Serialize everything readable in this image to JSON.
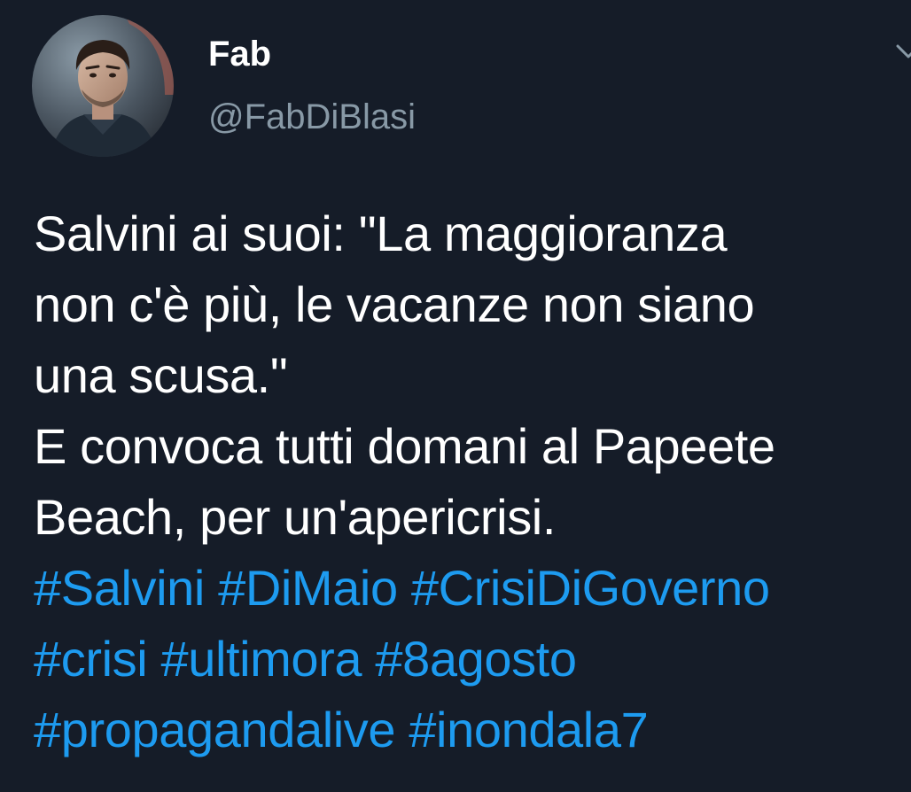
{
  "tweet": {
    "author": {
      "display_name": "Fab",
      "handle": "@FabDiBlasi",
      "avatar_icon": "profile-photo"
    },
    "menu_icon": "chevron-down-icon",
    "text_lines": [
      "Salvini ai suoi: \"La maggioranza",
      "non c'è più, le vacanze non siano",
      "una scusa.\"",
      "E convoca tutti domani al Papeete",
      "Beach, per un'apericrisi."
    ],
    "hashtag_lines": [
      [
        "#Salvini",
        "#DiMaio",
        "#CrisiDiGoverno"
      ],
      [
        "#crisi",
        "#ultimora",
        "#8agosto"
      ],
      [
        "#propagandalive",
        "#inondala7"
      ]
    ]
  },
  "colors": {
    "background": "#151c28",
    "text": "#ffffff",
    "secondary_text": "#8899a6",
    "link": "#1d9bf0"
  }
}
